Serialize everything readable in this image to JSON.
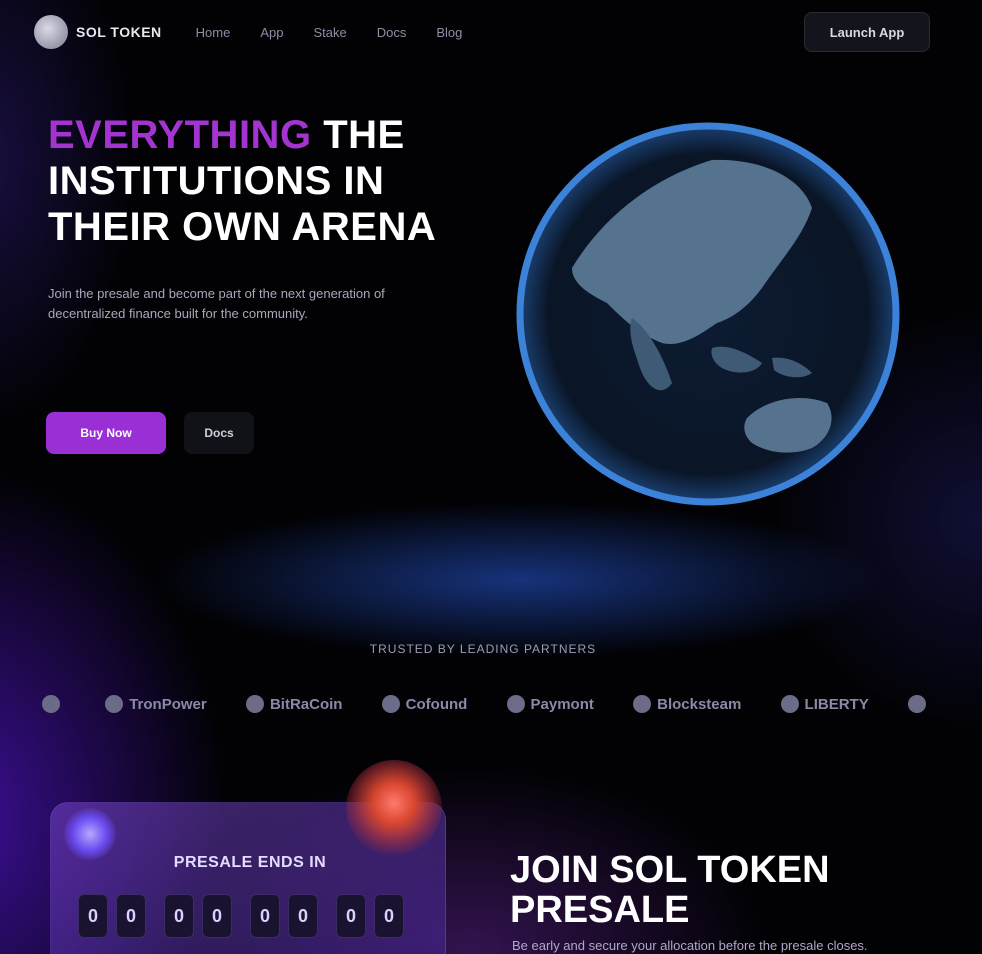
{
  "nav": {
    "brand": "SOL TOKEN",
    "links": [
      "Home",
      "App",
      "Stake",
      "Docs",
      "Blog"
    ],
    "cta": "Launch App"
  },
  "hero": {
    "title_accent": "EVERYTHING",
    "title_rest": "THE INSTITUTIONS IN THEIR OWN ARENA",
    "description": "Join the presale and become part of the next generation of decentralized finance built for the community.",
    "primary_button": "Buy Now",
    "secondary_button": "Docs"
  },
  "partners": {
    "heading": "TRUSTED BY LEADING PARTNERS",
    "items": [
      {
        "name": "",
        "icon": "partner-mark-icon"
      },
      {
        "name": "TronPower",
        "icon": "partner-mark-icon"
      },
      {
        "name": "BitRaCoin",
        "icon": "partner-mark-icon"
      },
      {
        "name": "Cofound",
        "icon": "partner-mark-icon"
      },
      {
        "name": "Paymont",
        "icon": "partner-mark-icon"
      },
      {
        "name": "Blocksteam",
        "icon": "partner-mark-icon"
      },
      {
        "name": "LIBERTY",
        "icon": "partner-mark-icon"
      },
      {
        "name": "",
        "icon": "partner-mark-icon"
      }
    ]
  },
  "presale": {
    "title": "PRESALE ENDS IN",
    "countdown": [
      {
        "digits": [
          "0",
          "0"
        ]
      },
      {
        "digits": [
          "0",
          "0"
        ]
      },
      {
        "digits": [
          "0",
          "0"
        ]
      },
      {
        "digits": [
          "0",
          "0"
        ]
      }
    ]
  },
  "join": {
    "title": "JOIN SOL TOKEN PRESALE",
    "description": "Be early and secure your allocation before the presale closes."
  },
  "colors": {
    "accent": "#a434d0",
    "primary_button": "#9b2fd6",
    "background": "#020205",
    "globe_rim": "#3b82d8"
  }
}
